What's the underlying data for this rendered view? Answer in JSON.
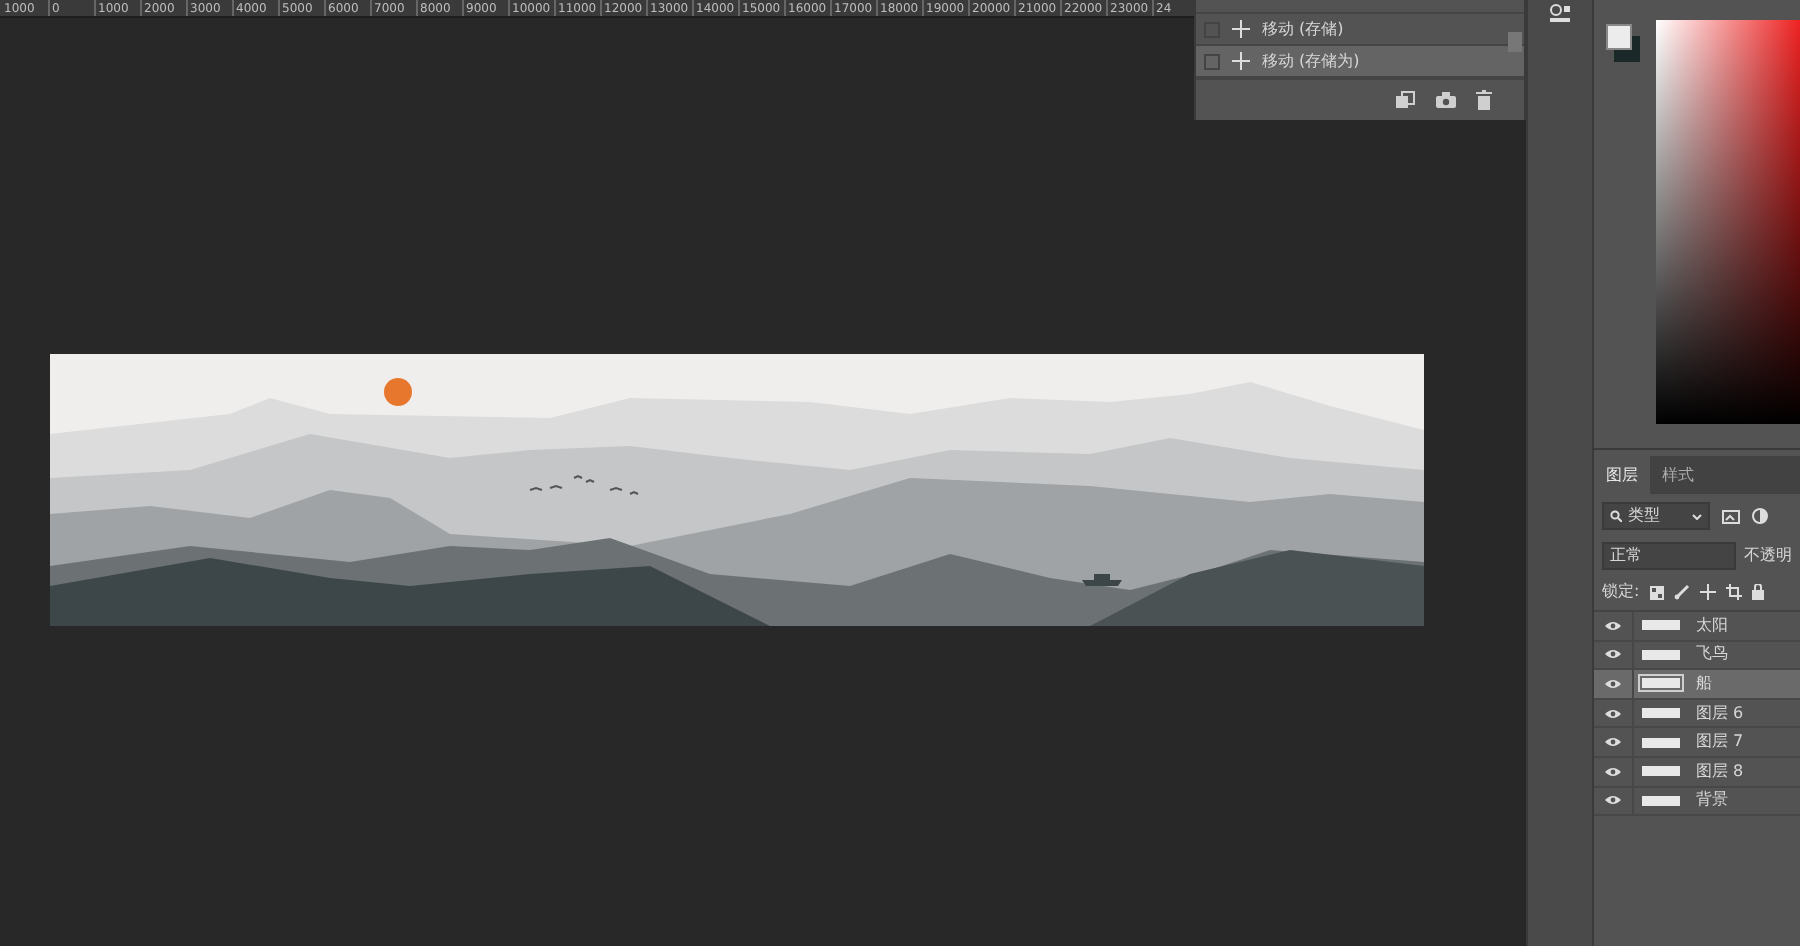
{
  "ruler": {
    "labels": [
      "1000",
      "0",
      "1000",
      "2000",
      "3000",
      "4000",
      "5000",
      "6000",
      "7000",
      "8000",
      "9000",
      "10000",
      "11000",
      "12000",
      "13000",
      "14000",
      "15000",
      "16000",
      "17000",
      "18000",
      "19000",
      "20000",
      "21000",
      "22000",
      "23000",
      "24"
    ]
  },
  "history": {
    "items": [
      {
        "label": "移动 (存储)",
        "selected": false
      },
      {
        "label": "移动 (存储为)",
        "selected": true
      }
    ]
  },
  "layers_panel": {
    "tabs": [
      {
        "label": "图层",
        "selected": true
      },
      {
        "label": "样式",
        "selected": false
      }
    ],
    "filter": "类型",
    "blend_mode": "正常",
    "opacity_label": "不透明",
    "lock_label": "锁定:",
    "layers": [
      {
        "name": "太阳",
        "visible": true,
        "selected": false
      },
      {
        "name": "飞鸟",
        "visible": true,
        "selected": false
      },
      {
        "name": "船",
        "visible": true,
        "selected": true
      },
      {
        "name": "图层 6",
        "visible": true,
        "selected": false
      },
      {
        "name": "图层 7",
        "visible": true,
        "selected": false
      },
      {
        "name": "图层 8",
        "visible": true,
        "selected": false
      },
      {
        "name": "背景",
        "visible": true,
        "selected": false
      }
    ]
  }
}
